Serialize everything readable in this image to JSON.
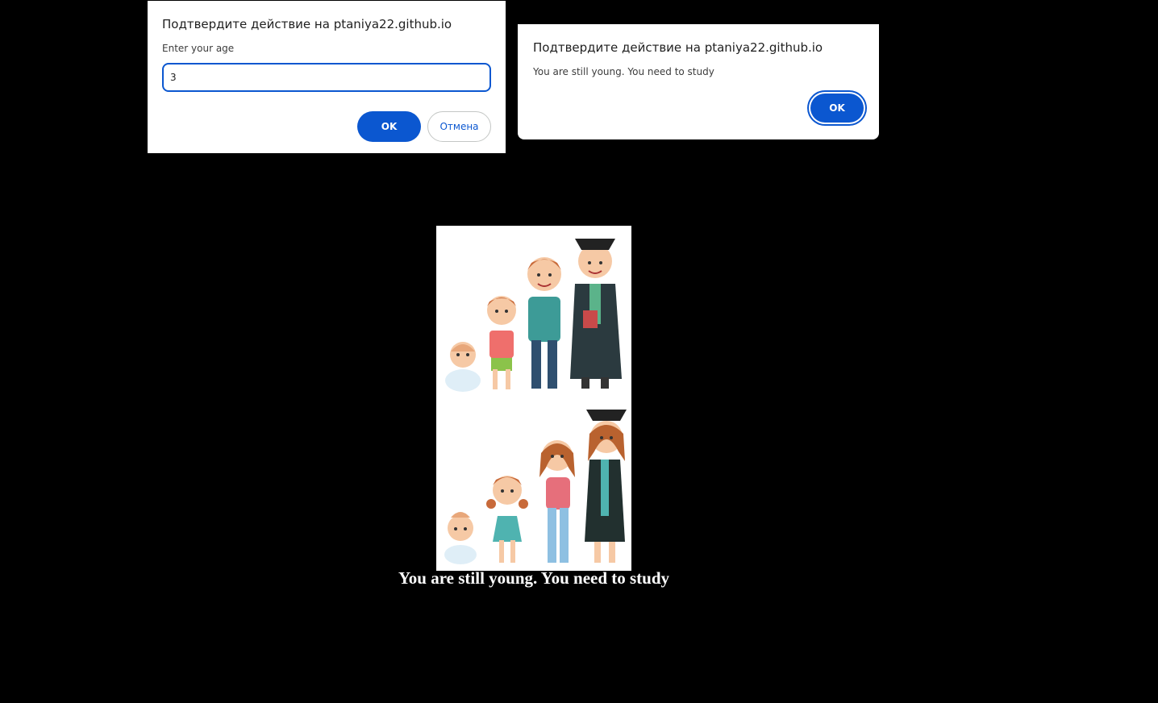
{
  "prompt_dialog": {
    "title": "Подтвердите действие на ptaniya22.github.io",
    "message": "Enter your age",
    "input_value": "3",
    "ok_label": "OK",
    "cancel_label": "Отмена"
  },
  "alert_dialog": {
    "title": "Подтвердите действие на ptaniya22.github.io",
    "message": "You are still young. You need to study",
    "ok_label": "OK"
  },
  "page": {
    "result_text": "You are still young. You need to study",
    "picture_description_icon": "growing-up-people-illustration"
  },
  "colors": {
    "accent": "#0b57d0",
    "background": "#000000"
  }
}
